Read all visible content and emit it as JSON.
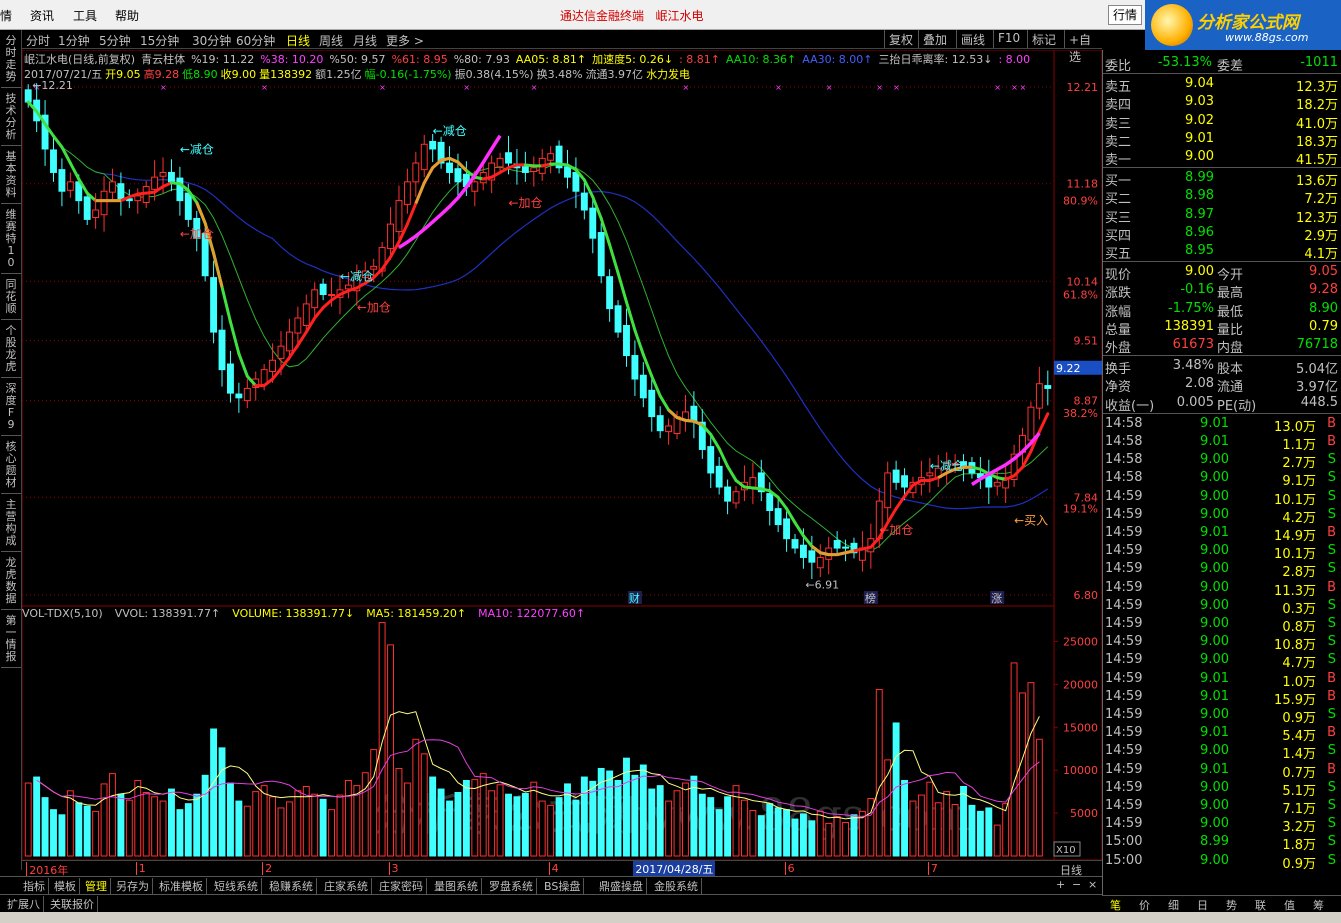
{
  "menu": {
    "items": [
      "情",
      "资讯",
      "工具",
      "帮助"
    ],
    "title": "通达信金融终端",
    "title_stock": "岷江水电",
    "right_tab": "行情"
  },
  "logo": {
    "name": "分析家公式网",
    "url": "www.88gs.com"
  },
  "left_tabs": [
    "分时走势",
    "技术分析",
    "基本资料",
    "维赛特10",
    "同花顺",
    "个股龙虎",
    "深度F9",
    "核心题材",
    "主营构成",
    "龙虎数据",
    "第一情报"
  ],
  "period_tabs": [
    "分时",
    "1分钟",
    "5分钟",
    "15分钟",
    "30分钟",
    "60分钟",
    "日线",
    "周线",
    "月线",
    "更多 >"
  ],
  "active_period": "日线",
  "tools": [
    "复权",
    "叠加",
    "画线",
    "F10",
    "标记",
    "+自选"
  ],
  "kline_header": {
    "line1": [
      {
        "text": "岷江水电(日线,前复权)",
        "color": "#c0c0c0"
      },
      {
        "text": "青云柱体",
        "color": "#c0c0c0"
      },
      {
        "text": "%19: 11.22",
        "color": "#c0c0c0"
      },
      {
        "text": "%38: 10.20",
        "color": "#ff40ff"
      },
      {
        "text": "%50: 9.57",
        "color": "#c0c0c0"
      },
      {
        "text": "%61: 8.95",
        "color": "#ff4040"
      },
      {
        "text": "%80: 7.93",
        "color": "#c0c0c0"
      },
      {
        "text": "AA05: 8.81↑",
        "color": "#ffff00"
      },
      {
        "text": "加速度5: 0.26↓",
        "color": "#ffff00"
      },
      {
        "text": ": 8.81↑",
        "color": "#ff4040"
      },
      {
        "text": "AA10: 8.36↑",
        "color": "#00e000"
      },
      {
        "text": "AA30: 8.00↑",
        "color": "#4060ff"
      },
      {
        "text": "三抬日乖离率: 12.53↓",
        "color": "#c0c0c0"
      },
      {
        "text": ": 8.00",
        "color": "#ff40ff"
      }
    ],
    "line2": [
      {
        "text": "2017/07/21/五",
        "color": "#c0c0c0"
      },
      {
        "text": "开9.05",
        "color": "#ffff00"
      },
      {
        "text": "高9.28",
        "color": "#ff4040"
      },
      {
        "text": "低8.90",
        "color": "#00e000"
      },
      {
        "text": "收9.00",
        "color": "#ffff00"
      },
      {
        "text": "量138392",
        "color": "#ffff00"
      },
      {
        "text": "额1.25亿",
        "color": "#c0c0c0"
      },
      {
        "text": "幅-0.16(-1.75%)",
        "color": "#00e000"
      },
      {
        "text": "振0.38(4.15%)",
        "color": "#c0c0c0"
      },
      {
        "text": "换3.48%",
        "color": "#c0c0c0"
      },
      {
        "text": "流通3.97亿",
        "color": "#c0c0c0"
      },
      {
        "text": "水力发电",
        "color": "#ffff00"
      }
    ]
  },
  "price_axis": [
    {
      "v": 12.21,
      "label": "12.21"
    },
    {
      "v": 11.18,
      "label": "11.18"
    },
    {
      "v": 10.14,
      "label": "10.14"
    },
    {
      "v": 9.51,
      "label": "9.51"
    },
    {
      "v": 8.87,
      "label": "8.87"
    },
    {
      "v": 7.84,
      "label": "7.84"
    },
    {
      "v": 6.8,
      "label": "6.80"
    }
  ],
  "pct_axis": [
    {
      "v": 11.0,
      "label": "80.9%"
    },
    {
      "v": 10.0,
      "label": "61.8%"
    },
    {
      "v": 8.74,
      "label": "38.2%"
    },
    {
      "v": 7.72,
      "label": "19.1%"
    }
  ],
  "current_price_tag": {
    "v": 9.22,
    "label": "9.22"
  },
  "high_label": "12.21",
  "low_label": "6.91",
  "annotations": [
    {
      "text": "←减仓",
      "color": "#40ffff",
      "idx": 18,
      "price": 11.5
    },
    {
      "text": "←加仓",
      "color": "#ff4040",
      "idx": 18,
      "price": 10.6
    },
    {
      "text": "←减仓",
      "color": "#40ffff",
      "idx": 37,
      "price": 10.15
    },
    {
      "text": "←加仓",
      "color": "#ff4040",
      "idx": 39,
      "price": 9.82
    },
    {
      "text": "←减仓",
      "color": "#40ffff",
      "idx": 48,
      "price": 11.7
    },
    {
      "text": "←加仓",
      "color": "#ff4040",
      "idx": 57,
      "price": 10.93
    },
    {
      "text": "←减仓",
      "color": "#40ffff",
      "idx": 107,
      "price": 8.13
    },
    {
      "text": "←加仓",
      "color": "#ff4040",
      "idx": 101,
      "price": 7.45
    },
    {
      "text": "←买入",
      "color": "#ffa040",
      "idx": 117,
      "price": 7.55
    }
  ],
  "event_markers": [
    {
      "text": "财",
      "idx": 72,
      "color": "#40ffff"
    },
    {
      "text": "榜",
      "idx": 100,
      "color": "#c0c0c0"
    },
    {
      "text": "涨",
      "idx": 115,
      "color": "#c0c0c0"
    }
  ],
  "vol_header": [
    {
      "text": "VOL-TDX(5,10)",
      "color": "#c0c0c0"
    },
    {
      "text": "VVOL: 138391.77↑",
      "color": "#c0c0c0"
    },
    {
      "text": "VOLUME: 138391.77↓",
      "color": "#ffff00"
    },
    {
      "text": "MA5: 181459.20↑",
      "color": "#ffff00"
    },
    {
      "text": "MA10: 122077.60↑",
      "color": "#ff40ff"
    }
  ],
  "vol_axis": [
    "25000",
    "20000",
    "15000",
    "10000",
    "5000"
  ],
  "vol_unit": "X10",
  "date_axis": [
    {
      "idx": 0,
      "label": "2016年"
    },
    {
      "idx": 13,
      "label": "1"
    },
    {
      "idx": 28,
      "label": "2"
    },
    {
      "idx": 43,
      "label": "3"
    },
    {
      "idx": 62,
      "label": "4"
    },
    {
      "idx": 90,
      "label": "6"
    },
    {
      "idx": 107,
      "label": "7"
    }
  ],
  "cursor_date": {
    "idx": 73,
    "label": "2017/04/28/五"
  },
  "watermark": "分析家公式网www.88gs.com",
  "bottom_tabs1": [
    "指标",
    "模板",
    "管理",
    "另存为",
    "标准模板",
    "短线系统",
    "稳赚系统",
    "庄家系统",
    "庄家密码",
    "量图系统",
    "罗盘系统",
    "BS操盘",
    "鼎盛操盘",
    "金股系统"
  ],
  "bottom_tabs2": [
    "扩展八",
    "关联报价"
  ],
  "right_tabs": [
    "笔",
    "价",
    "细",
    "日",
    "势",
    "联",
    "值",
    "筹"
  ],
  "quote": {
    "weibi": {
      "label": "委比",
      "value": "-53.13%",
      "diff_label": "委差",
      "diff": "-1011"
    },
    "asks": [
      {
        "label": "卖五",
        "price": "9.04",
        "vol": "12.3万"
      },
      {
        "label": "卖四",
        "price": "9.03",
        "vol": "18.2万"
      },
      {
        "label": "卖三",
        "price": "9.02",
        "vol": "41.0万"
      },
      {
        "label": "卖二",
        "price": "9.01",
        "vol": "18.3万"
      },
      {
        "label": "卖一",
        "price": "9.00",
        "vol": "41.5万"
      }
    ],
    "bids": [
      {
        "label": "买一",
        "price": "8.99",
        "vol": "13.6万"
      },
      {
        "label": "买二",
        "price": "8.98",
        "vol": "7.2万"
      },
      {
        "label": "买三",
        "price": "8.97",
        "vol": "12.3万"
      },
      {
        "label": "买四",
        "price": "8.96",
        "vol": "2.9万"
      },
      {
        "label": "买五",
        "price": "8.95",
        "vol": "4.1万"
      }
    ],
    "stats": [
      {
        "l1": "现价",
        "v1": "9.00",
        "c1": "#ffff00",
        "l2": "今开",
        "v2": "9.05",
        "c2": "#ff4040"
      },
      {
        "l1": "涨跌",
        "v1": "-0.16",
        "c1": "#00e000",
        "l2": "最高",
        "v2": "9.28",
        "c2": "#ff4040"
      },
      {
        "l1": "涨幅",
        "v1": "-1.75%",
        "c1": "#00e000",
        "l2": "最低",
        "v2": "8.90",
        "c2": "#00e000"
      },
      {
        "l1": "总量",
        "v1": "138391",
        "c1": "#ffff00",
        "l2": "量比",
        "v2": "0.79",
        "c2": "#ffff00"
      },
      {
        "l1": "外盘",
        "v1": "61673",
        "c1": "#ff4040",
        "l2": "内盘",
        "v2": "76718",
        "c2": "#00e000"
      }
    ],
    "fund": [
      {
        "l1": "换手",
        "v1": "3.48%",
        "l2": "股本",
        "v2": "5.04亿"
      },
      {
        "l1": "净资",
        "v1": "2.08",
        "l2": "流通",
        "v2": "3.97亿"
      },
      {
        "l1": "收益(一)",
        "v1": "0.005",
        "l2": "PE(动)",
        "v2": "448.5"
      }
    ],
    "ticks": [
      {
        "t": "14:58",
        "p": "9.01",
        "v": "13.0万",
        "s": "B"
      },
      {
        "t": "14:58",
        "p": "9.01",
        "v": "1.1万",
        "s": "B"
      },
      {
        "t": "14:58",
        "p": "9.00",
        "v": "2.7万",
        "s": "S"
      },
      {
        "t": "14:58",
        "p": "9.00",
        "v": "9.1万",
        "s": "S"
      },
      {
        "t": "14:59",
        "p": "9.00",
        "v": "10.1万",
        "s": "S"
      },
      {
        "t": "14:59",
        "p": "9.00",
        "v": "4.2万",
        "s": "S"
      },
      {
        "t": "14:59",
        "p": "9.01",
        "v": "14.9万",
        "s": "B"
      },
      {
        "t": "14:59",
        "p": "9.00",
        "v": "10.1万",
        "s": "S"
      },
      {
        "t": "14:59",
        "p": "9.00",
        "v": "2.8万",
        "s": "S"
      },
      {
        "t": "14:59",
        "p": "9.00",
        "v": "11.3万",
        "s": "B"
      },
      {
        "t": "14:59",
        "p": "9.00",
        "v": "0.3万",
        "s": "S"
      },
      {
        "t": "14:59",
        "p": "9.00",
        "v": "0.8万",
        "s": "S"
      },
      {
        "t": "14:59",
        "p": "9.00",
        "v": "10.8万",
        "s": "S"
      },
      {
        "t": "14:59",
        "p": "9.00",
        "v": "4.7万",
        "s": "S"
      },
      {
        "t": "14:59",
        "p": "9.01",
        "v": "1.0万",
        "s": "B"
      },
      {
        "t": "14:59",
        "p": "9.01",
        "v": "15.9万",
        "s": "B"
      },
      {
        "t": "14:59",
        "p": "9.00",
        "v": "0.9万",
        "s": "S"
      },
      {
        "t": "14:59",
        "p": "9.01",
        "v": "5.4万",
        "s": "B"
      },
      {
        "t": "14:59",
        "p": "9.00",
        "v": "1.4万",
        "s": "S"
      },
      {
        "t": "14:59",
        "p": "9.01",
        "v": "0.7万",
        "s": "B"
      },
      {
        "t": "14:59",
        "p": "9.00",
        "v": "5.1万",
        "s": "S"
      },
      {
        "t": "14:59",
        "p": "9.00",
        "v": "7.1万",
        "s": "S"
      },
      {
        "t": "14:59",
        "p": "9.00",
        "v": "3.2万",
        "s": "S"
      },
      {
        "t": "15:00",
        "p": "8.99",
        "v": "1.8万",
        "s": "S"
      },
      {
        "t": "15:00",
        "p": "9.00",
        "v": "0.9万",
        "s": "S"
      }
    ]
  },
  "chart_data": {
    "type": "candlestick",
    "title": "岷江水电(日线,前复权)",
    "y_range": [
      6.8,
      12.21
    ],
    "vol_range": [
      0,
      27500
    ],
    "closes": [
      12.05,
      11.85,
      11.55,
      11.3,
      11.1,
      11.2,
      11.0,
      10.8,
      10.9,
      11.1,
      11.2,
      11.0,
      11.0,
      11.05,
      11.15,
      11.25,
      11.3,
      11.2,
      11.0,
      10.8,
      10.6,
      10.2,
      9.6,
      9.2,
      8.95,
      8.9,
      9.0,
      9.1,
      9.2,
      9.3,
      9.45,
      9.6,
      9.75,
      9.9,
      10.05,
      10.0,
      10.0,
      10.05,
      10.1,
      10.2,
      10.25,
      10.3,
      10.5,
      10.75,
      11.0,
      11.2,
      11.4,
      11.6,
      11.55,
      11.4,
      11.3,
      11.2,
      11.15,
      11.2,
      11.3,
      11.4,
      11.45,
      11.4,
      11.35,
      11.3,
      11.35,
      11.45,
      11.5,
      11.35,
      11.25,
      11.1,
      10.9,
      10.6,
      10.2,
      9.85,
      9.6,
      9.35,
      9.1,
      8.9,
      8.7,
      8.55,
      8.6,
      8.7,
      8.75,
      8.65,
      8.35,
      8.1,
      7.95,
      7.8,
      7.9,
      8.0,
      8.05,
      7.9,
      7.7,
      7.55,
      7.4,
      7.3,
      7.2,
      7.15,
      7.2,
      7.3,
      7.3,
      7.3,
      7.25,
      7.3,
      7.4,
      7.8,
      8.1,
      8.0,
      7.95,
      8.0,
      8.05,
      8.1,
      8.15,
      8.2,
      8.2,
      8.15,
      8.1,
      8.05,
      7.95,
      8.0,
      8.05,
      8.3,
      8.5,
      8.8,
      9.05,
      9.0
    ],
    "volumes": [
      8500,
      9200,
      6800,
      5400,
      4800,
      7600,
      6200,
      5800,
      5200,
      8400,
      9600,
      7200,
      6500,
      8800,
      7400,
      6900,
      6400,
      7800,
      5400,
      6100,
      7200,
      9400,
      14800,
      12600,
      8500,
      6400,
      5800,
      7500,
      8200,
      6900,
      5600,
      6300,
      7600,
      8100,
      7200,
      6600,
      5400,
      7100,
      8800,
      8200,
      9700,
      12400,
      27200,
      24600,
      10200,
      8500,
      13600,
      11900,
      9200,
      7800,
      6400,
      7400,
      8800,
      8900,
      9600,
      7600,
      8300,
      7200,
      6900,
      7300,
      8600,
      6400,
      5900,
      6800,
      8400,
      6500,
      9200,
      8700,
      10200,
      9900,
      8800,
      11400,
      9400,
      10600,
      7800,
      8200,
      6400,
      7600,
      8500,
      9300,
      7200,
      6800,
      5400,
      6900,
      8200,
      6500,
      5300,
      4700,
      6100,
      5600,
      5400,
      4300,
      4900,
      4100,
      5200,
      3800,
      4600,
      3900,
      4800,
      5200,
      6700,
      19400,
      11200,
      15500,
      8800,
      6400,
      7100,
      8600,
      6200,
      7500,
      6000,
      8100,
      5900,
      5200,
      5600,
      3600,
      6100,
      22500,
      19000,
      20200,
      13600
    ]
  }
}
